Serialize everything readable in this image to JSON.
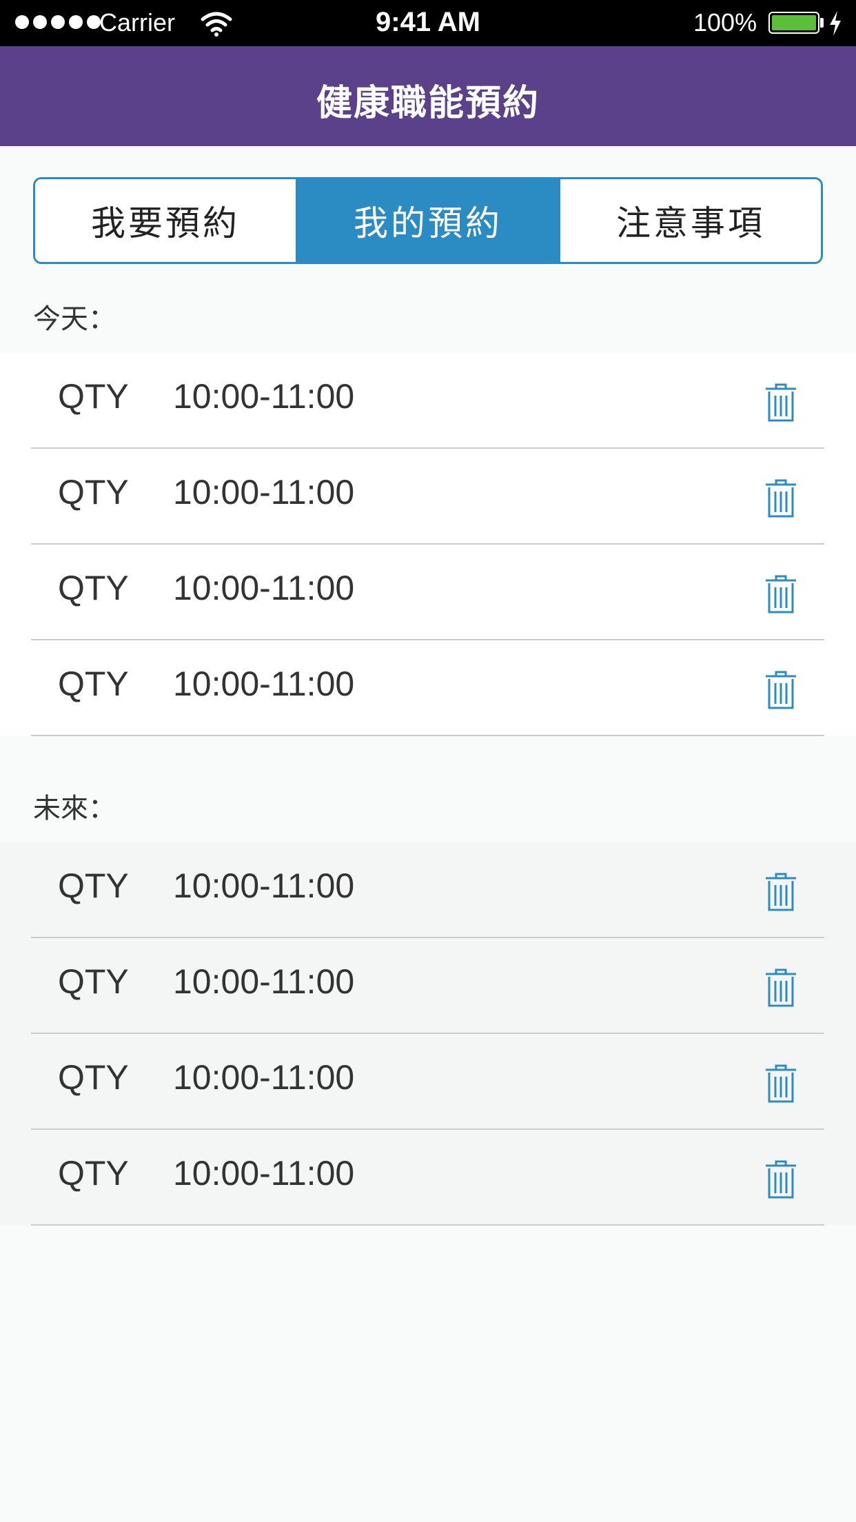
{
  "status_bar": {
    "carrier": "Carrier",
    "time": "9:41 AM",
    "battery": "100%"
  },
  "nav": {
    "title": "健康職能預約"
  },
  "tabs": [
    {
      "label": "我要預約",
      "active": false
    },
    {
      "label": "我的預約",
      "active": true
    },
    {
      "label": "注意事項",
      "active": false
    }
  ],
  "today": {
    "label": "今天：",
    "items": [
      {
        "label": "QTY",
        "time": "10:00-11:00"
      },
      {
        "label": "QTY",
        "time": "10:00-11:00"
      },
      {
        "label": "QTY",
        "time": "10:00-11:00"
      },
      {
        "label": "QTY",
        "time": "10:00-11:00"
      }
    ]
  },
  "future": {
    "label": "未來：",
    "items": [
      {
        "label": "QTY",
        "time": "10:00-11:00"
      },
      {
        "label": "QTY",
        "time": "10:00-11:00"
      },
      {
        "label": "QTY",
        "time": "10:00-11:00"
      },
      {
        "label": "QTY",
        "time": "10:00-11:00"
      }
    ]
  },
  "icons": {
    "delete": "trash-icon",
    "wifi": "wifi-icon",
    "battery": "battery-icon",
    "charging": "charging-bolt-icon"
  },
  "colors": {
    "nav_bg": "#5a4189",
    "accent": "#2b8bc3",
    "battery_fill": "#5bbf3a"
  }
}
